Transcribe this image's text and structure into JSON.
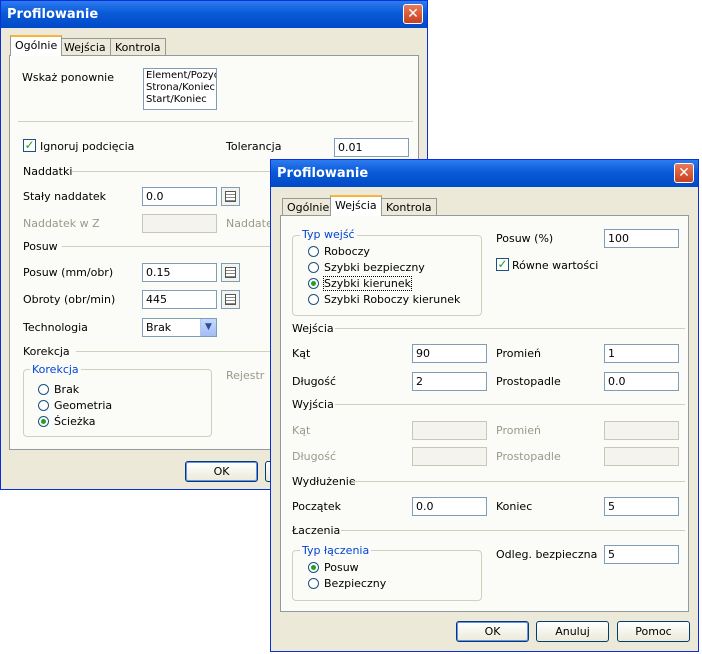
{
  "back": {
    "title": "Profilowanie",
    "tabs": [
      "Ogólnie",
      "Wejścia",
      "Kontrola"
    ],
    "wskaz_label": "Wskaż ponownie",
    "wskaz_list": [
      "Element/Pozyc",
      "Strona/Koniec",
      "Start/Koniec"
    ],
    "ignoruj_label": "Ignoruj podcięcia",
    "ignoruj_checked": true,
    "tolerancja_label": "Tolerancja",
    "tolerancja_value": "0.01",
    "naddatki_group": "Naddatki",
    "staly_label": "Stały naddatek",
    "staly_value": "0.0",
    "naddatek_z_label": "Naddatek w Z",
    "naddatek_label2": "Naddatek",
    "posuw_group": "Posuw",
    "posuw_label": "Posuw (mm/obr)",
    "posuw_value": "0.15",
    "obroty_label": "Obroty (obr/min)",
    "obroty_value": "445",
    "technologia_label": "Technologia",
    "technologia_value": "Brak",
    "korekcja_group": "Korekcja",
    "korekcja_box": "Korekcja",
    "rejestr_label": "Rejestr",
    "korekcja_options": [
      "Brak",
      "Geometria",
      "Ścieżka"
    ],
    "korekcja_selected": 2,
    "ok_label": "OK"
  },
  "front": {
    "title": "Profilowanie",
    "tabs": [
      "Ogólnie",
      "Wejścia",
      "Kontrola"
    ],
    "active_tab": 1,
    "typ_wejsc_box": "Typ wejść",
    "typ_wejsc_options": [
      "Roboczy",
      "Szybki bezpieczny",
      "Szybki kierunek",
      "Szybki Roboczy kierunek"
    ],
    "typ_wejsc_selected": 2,
    "posuw_pct_label": "Posuw (%)",
    "posuw_pct_value": "100",
    "rowne_label": "Równe wartości",
    "rowne_checked": true,
    "wejscia_group": "Wejścia",
    "kat_label": "Kąt",
    "kat_value": "90",
    "promien_label": "Promień",
    "promien_value": "1",
    "dlugosc_label": "Długość",
    "dlugosc_value": "2",
    "prostopadle_label": "Prostopadle",
    "prostopadle_value": "0.0",
    "wyjscia_group": "Wyjścia",
    "w_kat_label": "Kąt",
    "w_promien_label": "Promień",
    "w_dlugosc_label": "Długość",
    "w_prostopadle_label": "Prostopadle",
    "wydluzenie_group": "Wydłużenie",
    "poczatek_label": "Początek",
    "poczatek_value": "0.0",
    "koniec_label": "Koniec",
    "koniec_value": "5",
    "laczenia_group": "Łaczenia",
    "typ_laczenia_box": "Typ łączenia",
    "typ_laczenia_options": [
      "Posuw",
      "Bezpieczny"
    ],
    "typ_laczenia_selected": 0,
    "odleg_label": "Odleg. bezpieczna",
    "odleg_value": "5",
    "ok_label": "OK",
    "anuluj_label": "Anuluj",
    "pomoc_label": "Pomoc"
  }
}
